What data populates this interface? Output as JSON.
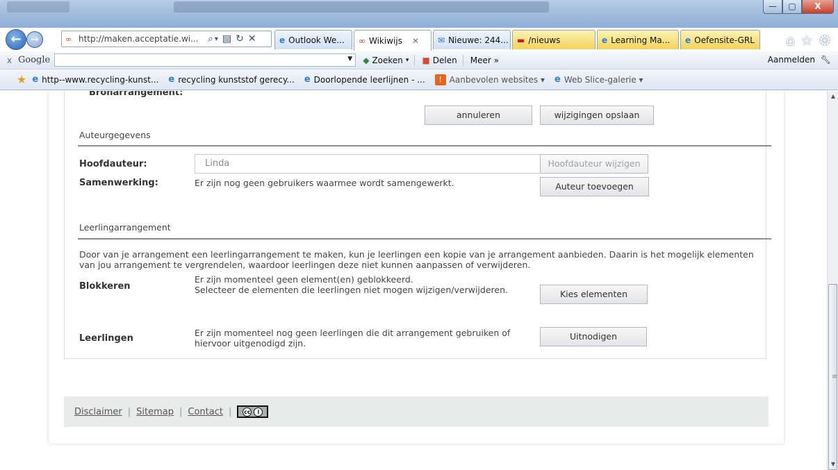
{
  "browser": {
    "address_url": "http://maken.acceptatie.wi...",
    "tabs": [
      {
        "label": "Outlook We...",
        "icon": "ie-icon"
      },
      {
        "label": "Wikiwijs",
        "icon": "wikiwijs-icon"
      },
      {
        "label": "Nieuwe: 244...",
        "icon": "mail-icon"
      },
      {
        "label": "/nieuws",
        "icon": "news-icon"
      },
      {
        "label": "Learning Ma...",
        "icon": "ie-icon"
      },
      {
        "label": "Oefensite-GRL",
        "icon": "ie-icon"
      }
    ],
    "window_buttons": {
      "minimize": "—",
      "maximize": "▢",
      "close": "X"
    },
    "nav": {
      "back": "←",
      "forward": "→"
    },
    "icons": {
      "search": "⌕",
      "dropdown": "▾",
      "compat": "▤",
      "refresh": "↻",
      "stop": "✕",
      "home": "⌂",
      "favorites": "☆",
      "settings": "⚙"
    }
  },
  "google_toolbar": {
    "close": "x",
    "logo": "Google",
    "search_value": "",
    "search_label": "Zoeken",
    "share_label": "Delen",
    "more_label": "Meer »",
    "signin_label": "Aanmelden"
  },
  "favorites_bar": {
    "items": [
      {
        "label": "http--www.recycling-kunst..."
      },
      {
        "label": "recycling kunststof gerecy..."
      },
      {
        "label": "Doorlopende leerlijnen - ..."
      },
      {
        "label": "Aanbevolen websites ▾"
      },
      {
        "label": "Web Slice-galerie ▾"
      }
    ]
  },
  "form": {
    "bron_label": "Bronarrangement:",
    "cancel_button": "annuleren",
    "save_button": "wijzigingen opslaan",
    "author_section": "Auteurgegevens",
    "main_author_label": "Hoofdauteur:",
    "main_author_value": "Linda",
    "change_author_button": "Hoofdauteur wijzigen",
    "collab_label": "Samenwerking:",
    "collab_text": "Er zijn nog geen gebruikers waarmee wordt samengewerkt.",
    "add_author_button": "Auteur toevoegen",
    "student_section": "Leerlingarrangement",
    "student_intro": "Door van je arrangement een leerlingarrangement te maken, kun je leerlingen een kopie van je arrangement aanbieden. Daarin is het mogelijk elementen van jou arrangement te vergrendelen, waardoor leerlingen deze niet kunnen aanpassen of verwijderen.",
    "block_label": "Blokkeren",
    "block_text_1": "Er zijn momenteel geen element(en) geblokkeerd.",
    "block_text_2": "Selecteer de elementen die leerlingen niet mogen wijzigen/verwijderen.",
    "choose_elements_button": "Kies elementen",
    "students_label": "Leerlingen",
    "students_text": "Er zijn momenteel nog geen leerlingen die dit arrangement gebruiken of hiervoor uitgenodigd zijn.",
    "invite_button": "Uitnodigen"
  },
  "footer": {
    "disclaimer": "Disclaimer",
    "sitemap": "Sitemap",
    "contact": "Contact",
    "separator": "|",
    "license_badge": "cc"
  }
}
